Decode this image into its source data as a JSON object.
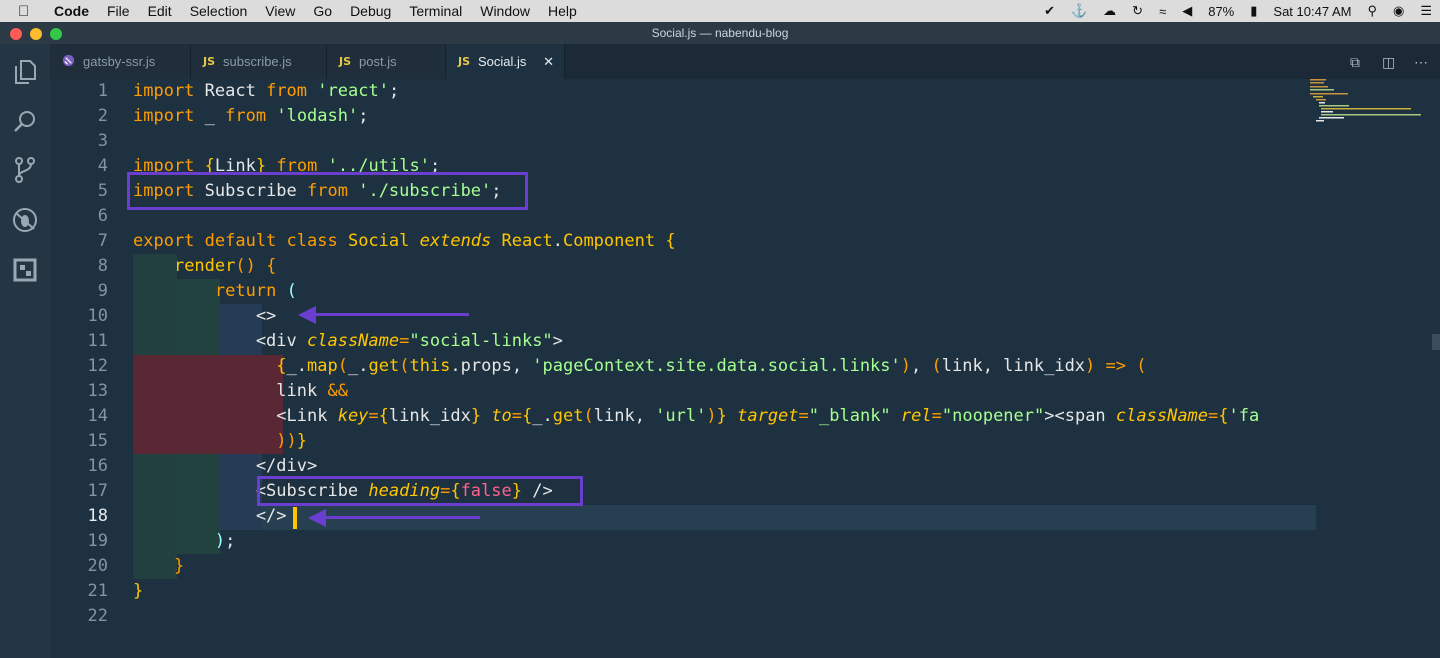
{
  "menubar": {
    "app": "Code",
    "items": [
      "File",
      "Edit",
      "Selection",
      "View",
      "Go",
      "Debug",
      "Terminal",
      "Window",
      "Help"
    ],
    "battery": "87%",
    "clock": "Sat 10:47 AM"
  },
  "window": {
    "title": "Social.js — nabendu-blog"
  },
  "tabs": [
    {
      "label": "gatsby-ssr.js",
      "icon": "gatsby-icon"
    },
    {
      "label": "subscribe.js",
      "icon": "js"
    },
    {
      "label": "post.js",
      "icon": "js"
    },
    {
      "label": "Social.js",
      "icon": "js",
      "active": true
    }
  ],
  "tab_js_badge": "JS",
  "editor": {
    "line_numbers": [
      "1",
      "2",
      "3",
      "4",
      "5",
      "6",
      "7",
      "8",
      "9",
      "10",
      "11",
      "12",
      "13",
      "14",
      "15",
      "16",
      "17",
      "18",
      "19",
      "20",
      "21",
      "22"
    ]
  },
  "colors": {
    "highlight": "#6a3fd0",
    "cursor": "#ffc600",
    "background": "#1e3140"
  }
}
